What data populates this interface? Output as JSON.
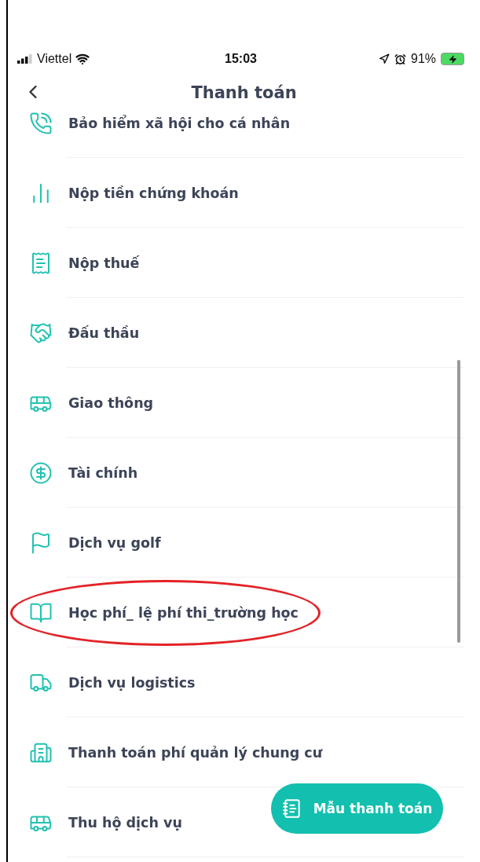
{
  "status_bar": {
    "carrier": "Viettel",
    "time": "15:03",
    "battery": "91%"
  },
  "header": {
    "title": "Thanh toán"
  },
  "items": [
    {
      "label": "Bảo hiểm xã hội cho cá nhân",
      "kind": "insurance",
      "highlighted": false
    },
    {
      "label": "Nộp tiền chứng khoán",
      "kind": "stocks",
      "highlighted": false
    },
    {
      "label": "Nộp thuế",
      "kind": "tax",
      "highlighted": false
    },
    {
      "label": "Đấu thầu",
      "kind": "bidding",
      "highlighted": false
    },
    {
      "label": "Giao thông",
      "kind": "bus",
      "highlighted": false
    },
    {
      "label": "Tài chính",
      "kind": "finance",
      "highlighted": false
    },
    {
      "label": "Dịch vụ golf",
      "kind": "golf",
      "highlighted": false
    },
    {
      "label": "Học phí_ lệ phí thi_trường học",
      "kind": "school",
      "highlighted": true
    },
    {
      "label": "Dịch vụ logistics",
      "kind": "logistics",
      "highlighted": false
    },
    {
      "label": "Thanh toán phí quản lý chung cư",
      "kind": "apartment",
      "highlighted": false
    },
    {
      "label": "Thu hộ dịch vụ",
      "kind": "bus",
      "highlighted": false
    }
  ],
  "fab": {
    "label": "Mẫu thanh toán"
  }
}
